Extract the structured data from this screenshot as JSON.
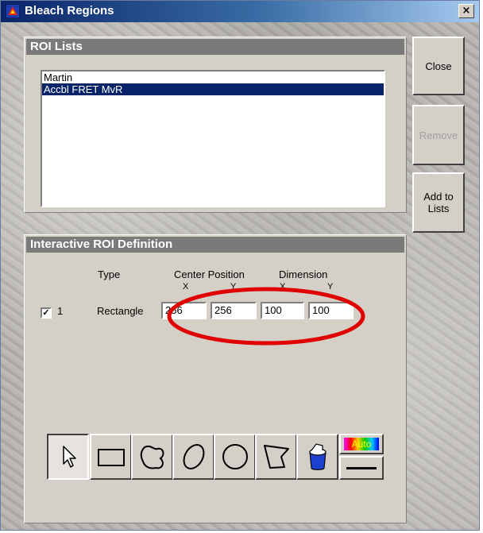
{
  "window": {
    "title": "Bleach Regions",
    "close_glyph": "×"
  },
  "roi_lists": {
    "header": "ROI Lists",
    "items": [
      {
        "label": "Martin",
        "selected": false
      },
      {
        "label": "Accbl FRET MvR",
        "selected": true
      }
    ]
  },
  "buttons": {
    "close": "Close",
    "remove": "Remove",
    "add_to_lists": "Add to Lists"
  },
  "definition": {
    "header": "Interactive ROI Definition",
    "col_type": "Type",
    "col_center": "Center Position",
    "col_dimension": "Dimension",
    "axis_x1": "X",
    "axis_y1": "Y",
    "axis_x2": "X",
    "axis_y2": "Y",
    "row": {
      "checked": true,
      "check_glyph": "✓",
      "index": "1",
      "type": "Rectangle",
      "center_x": "256",
      "center_y": "256",
      "dim_x": "100",
      "dim_y": "100"
    }
  },
  "tools": {
    "auto_label": "Auto",
    "items": [
      "arrow-icon",
      "rectangle-icon",
      "freehand-icon",
      "ellipse-icon",
      "circle-icon",
      "polygon-icon",
      "paint-bucket-icon"
    ]
  },
  "colors": {
    "title_gradient_start": "#0a246a",
    "selection": "#0a246a",
    "panel_header": "#7a7a7a",
    "annotation": "#e00000"
  }
}
